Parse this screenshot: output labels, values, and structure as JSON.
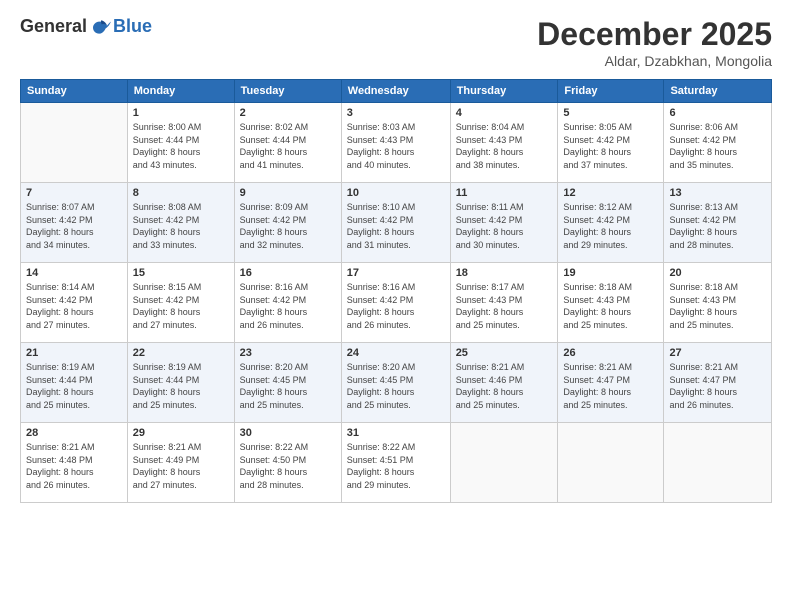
{
  "logo": {
    "general": "General",
    "blue": "Blue"
  },
  "header": {
    "title": "December 2025",
    "subtitle": "Aldar, Dzabkhan, Mongolia"
  },
  "weekdays": [
    "Sunday",
    "Monday",
    "Tuesday",
    "Wednesday",
    "Thursday",
    "Friday",
    "Saturday"
  ],
  "weeks": [
    [
      {
        "day": "",
        "sunrise": "",
        "sunset": "",
        "daylight": ""
      },
      {
        "day": "1",
        "sunrise": "Sunrise: 8:00 AM",
        "sunset": "Sunset: 4:44 PM",
        "daylight": "Daylight: 8 hours and 43 minutes."
      },
      {
        "day": "2",
        "sunrise": "Sunrise: 8:02 AM",
        "sunset": "Sunset: 4:44 PM",
        "daylight": "Daylight: 8 hours and 41 minutes."
      },
      {
        "day": "3",
        "sunrise": "Sunrise: 8:03 AM",
        "sunset": "Sunset: 4:43 PM",
        "daylight": "Daylight: 8 hours and 40 minutes."
      },
      {
        "day": "4",
        "sunrise": "Sunrise: 8:04 AM",
        "sunset": "Sunset: 4:43 PM",
        "daylight": "Daylight: 8 hours and 38 minutes."
      },
      {
        "day": "5",
        "sunrise": "Sunrise: 8:05 AM",
        "sunset": "Sunset: 4:42 PM",
        "daylight": "Daylight: 8 hours and 37 minutes."
      },
      {
        "day": "6",
        "sunrise": "Sunrise: 8:06 AM",
        "sunset": "Sunset: 4:42 PM",
        "daylight": "Daylight: 8 hours and 35 minutes."
      }
    ],
    [
      {
        "day": "7",
        "sunrise": "Sunrise: 8:07 AM",
        "sunset": "Sunset: 4:42 PM",
        "daylight": "Daylight: 8 hours and 34 minutes."
      },
      {
        "day": "8",
        "sunrise": "Sunrise: 8:08 AM",
        "sunset": "Sunset: 4:42 PM",
        "daylight": "Daylight: 8 hours and 33 minutes."
      },
      {
        "day": "9",
        "sunrise": "Sunrise: 8:09 AM",
        "sunset": "Sunset: 4:42 PM",
        "daylight": "Daylight: 8 hours and 32 minutes."
      },
      {
        "day": "10",
        "sunrise": "Sunrise: 8:10 AM",
        "sunset": "Sunset: 4:42 PM",
        "daylight": "Daylight: 8 hours and 31 minutes."
      },
      {
        "day": "11",
        "sunrise": "Sunrise: 8:11 AM",
        "sunset": "Sunset: 4:42 PM",
        "daylight": "Daylight: 8 hours and 30 minutes."
      },
      {
        "day": "12",
        "sunrise": "Sunrise: 8:12 AM",
        "sunset": "Sunset: 4:42 PM",
        "daylight": "Daylight: 8 hours and 29 minutes."
      },
      {
        "day": "13",
        "sunrise": "Sunrise: 8:13 AM",
        "sunset": "Sunset: 4:42 PM",
        "daylight": "Daylight: 8 hours and 28 minutes."
      }
    ],
    [
      {
        "day": "14",
        "sunrise": "Sunrise: 8:14 AM",
        "sunset": "Sunset: 4:42 PM",
        "daylight": "Daylight: 8 hours and 27 minutes."
      },
      {
        "day": "15",
        "sunrise": "Sunrise: 8:15 AM",
        "sunset": "Sunset: 4:42 PM",
        "daylight": "Daylight: 8 hours and 27 minutes."
      },
      {
        "day": "16",
        "sunrise": "Sunrise: 8:16 AM",
        "sunset": "Sunset: 4:42 PM",
        "daylight": "Daylight: 8 hours and 26 minutes."
      },
      {
        "day": "17",
        "sunrise": "Sunrise: 8:16 AM",
        "sunset": "Sunset: 4:42 PM",
        "daylight": "Daylight: 8 hours and 26 minutes."
      },
      {
        "day": "18",
        "sunrise": "Sunrise: 8:17 AM",
        "sunset": "Sunset: 4:43 PM",
        "daylight": "Daylight: 8 hours and 25 minutes."
      },
      {
        "day": "19",
        "sunrise": "Sunrise: 8:18 AM",
        "sunset": "Sunset: 4:43 PM",
        "daylight": "Daylight: 8 hours and 25 minutes."
      },
      {
        "day": "20",
        "sunrise": "Sunrise: 8:18 AM",
        "sunset": "Sunset: 4:43 PM",
        "daylight": "Daylight: 8 hours and 25 minutes."
      }
    ],
    [
      {
        "day": "21",
        "sunrise": "Sunrise: 8:19 AM",
        "sunset": "Sunset: 4:44 PM",
        "daylight": "Daylight: 8 hours and 25 minutes."
      },
      {
        "day": "22",
        "sunrise": "Sunrise: 8:19 AM",
        "sunset": "Sunset: 4:44 PM",
        "daylight": "Daylight: 8 hours and 25 minutes."
      },
      {
        "day": "23",
        "sunrise": "Sunrise: 8:20 AM",
        "sunset": "Sunset: 4:45 PM",
        "daylight": "Daylight: 8 hours and 25 minutes."
      },
      {
        "day": "24",
        "sunrise": "Sunrise: 8:20 AM",
        "sunset": "Sunset: 4:45 PM",
        "daylight": "Daylight: 8 hours and 25 minutes."
      },
      {
        "day": "25",
        "sunrise": "Sunrise: 8:21 AM",
        "sunset": "Sunset: 4:46 PM",
        "daylight": "Daylight: 8 hours and 25 minutes."
      },
      {
        "day": "26",
        "sunrise": "Sunrise: 8:21 AM",
        "sunset": "Sunset: 4:47 PM",
        "daylight": "Daylight: 8 hours and 25 minutes."
      },
      {
        "day": "27",
        "sunrise": "Sunrise: 8:21 AM",
        "sunset": "Sunset: 4:47 PM",
        "daylight": "Daylight: 8 hours and 26 minutes."
      }
    ],
    [
      {
        "day": "28",
        "sunrise": "Sunrise: 8:21 AM",
        "sunset": "Sunset: 4:48 PM",
        "daylight": "Daylight: 8 hours and 26 minutes."
      },
      {
        "day": "29",
        "sunrise": "Sunrise: 8:21 AM",
        "sunset": "Sunset: 4:49 PM",
        "daylight": "Daylight: 8 hours and 27 minutes."
      },
      {
        "day": "30",
        "sunrise": "Sunrise: 8:22 AM",
        "sunset": "Sunset: 4:50 PM",
        "daylight": "Daylight: 8 hours and 28 minutes."
      },
      {
        "day": "31",
        "sunrise": "Sunrise: 8:22 AM",
        "sunset": "Sunset: 4:51 PM",
        "daylight": "Daylight: 8 hours and 29 minutes."
      },
      {
        "day": "",
        "sunrise": "",
        "sunset": "",
        "daylight": ""
      },
      {
        "day": "",
        "sunrise": "",
        "sunset": "",
        "daylight": ""
      },
      {
        "day": "",
        "sunrise": "",
        "sunset": "",
        "daylight": ""
      }
    ]
  ]
}
